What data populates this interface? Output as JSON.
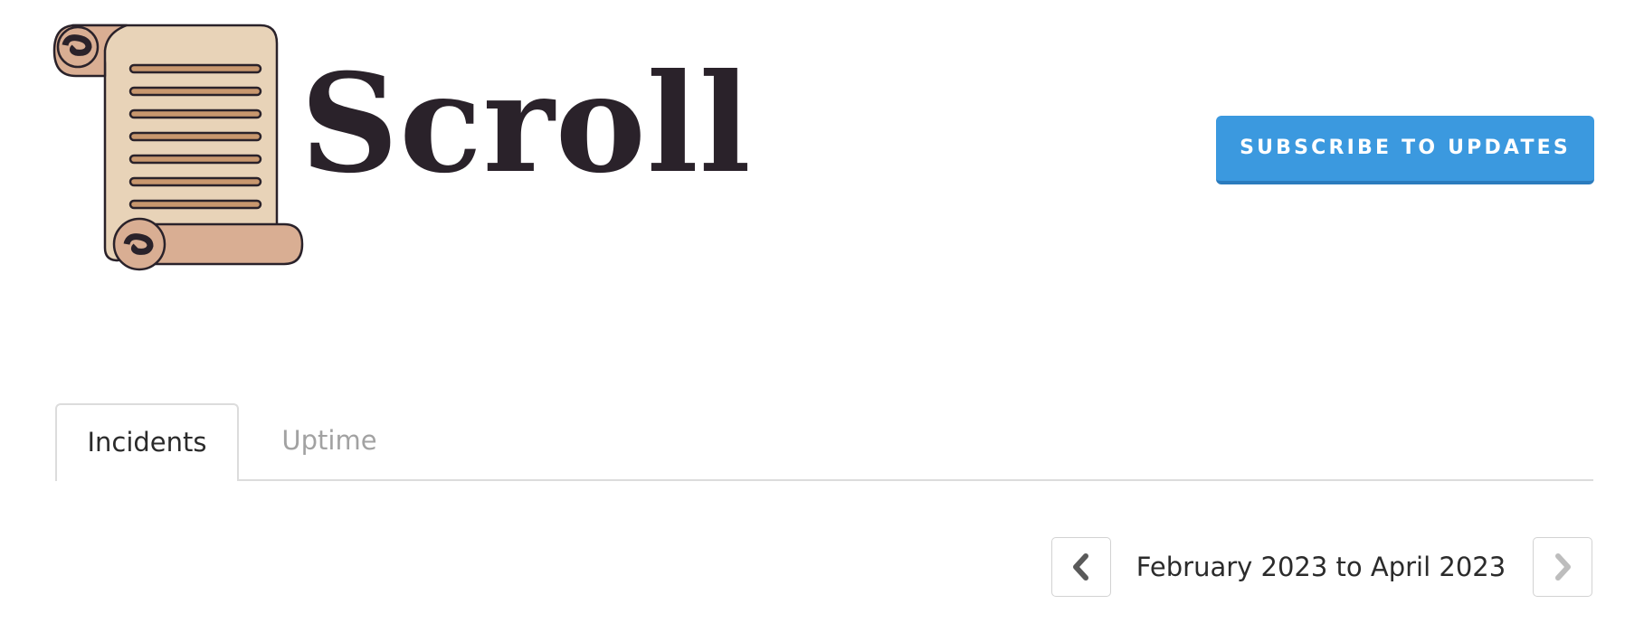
{
  "header": {
    "brand_name": "Scroll",
    "logo_icon": "parchment-scroll-icon",
    "subscribe_label": "SUBSCRIBE TO UPDATES"
  },
  "tabs": [
    {
      "label": "Incidents",
      "active": true
    },
    {
      "label": "Uptime",
      "active": false
    }
  ],
  "pagination": {
    "range_label": "February 2023 to April 2023",
    "prev_icon": "chevron-left-icon",
    "next_icon": "chevron-right-icon",
    "next_disabled": true
  },
  "colors": {
    "accent": "#3b99df",
    "brand_text": "#2a222a",
    "parchment": "#e8d3b8",
    "parchment_roll": "#d9ae93",
    "scroll_lines": "#c8976e"
  }
}
